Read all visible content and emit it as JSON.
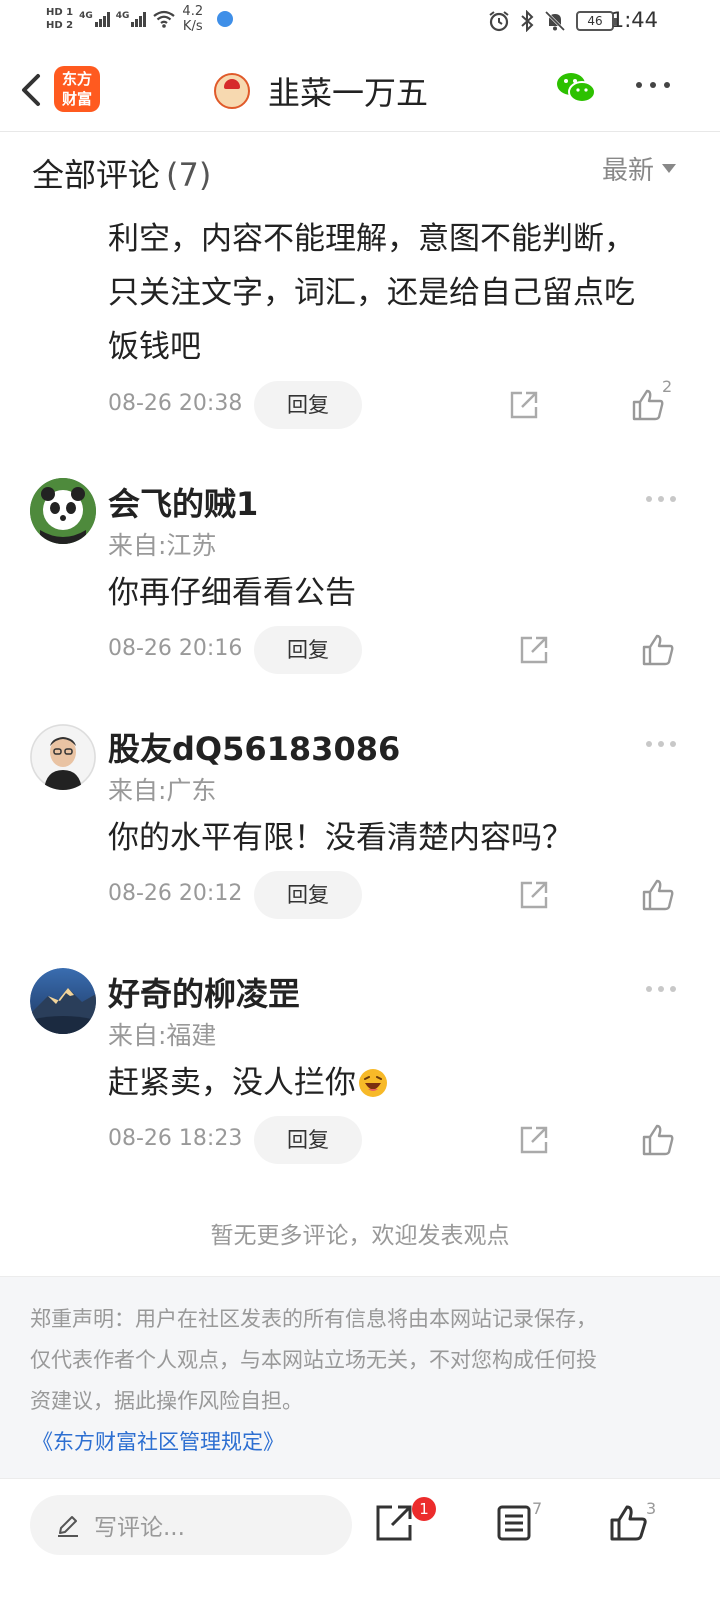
{
  "status_bar": {
    "hd_top": "HD 1",
    "hd_bottom": "HD 2",
    "net1": "4G",
    "net2": "4G",
    "speed_value": "4.2",
    "speed_unit": "K/s",
    "battery": "46",
    "time": "1:44"
  },
  "nav": {
    "logo_line1": "东方",
    "logo_line2": "财富",
    "title": "韭菜一万五"
  },
  "comments_header": {
    "label": "全部评论",
    "count": "(7)",
    "sort": "最新"
  },
  "comments": [
    {
      "text_lines": [
        "利空，内容不能理解，意图不能判断，",
        "只关注文字，词汇，还是给自己留点吃",
        "饭钱吧"
      ],
      "time": "08-26 20:38",
      "reply": "回复",
      "likes": "2"
    },
    {
      "name": "会飞的贼1",
      "location": "来自:江苏",
      "text": "你再仔细看看公告",
      "time": "08-26 20:16",
      "reply": "回复"
    },
    {
      "name": "股友dQ56183086",
      "location": "来自:广东",
      "text": "你的水平有限！没看清楚内容吗？",
      "time": "08-26 20:12",
      "reply": "回复"
    },
    {
      "name": "好奇的柳凌罡",
      "location": "来自:福建",
      "text": "赶紧卖，没人拦你",
      "time": "08-26 18:23",
      "reply": "回复"
    }
  ],
  "no_more": "暂无更多评论，欢迎发表观点",
  "disclaimer": {
    "text_lines": [
      "郑重声明：用户在社区发表的所有信息将由本网站记录保存，",
      "仅代表作者个人观点，与本网站立场无关，不对您构成任何投",
      "资建议，据此操作风险自担。"
    ],
    "link": "《东方财富社区管理规定》"
  },
  "bottom_bar": {
    "placeholder": "写评论...",
    "share_badge": "1",
    "comment_count": "7",
    "like_count": "3"
  },
  "colors": {
    "brand_orange": "#ff5a1f",
    "wechat_green": "#2dc100",
    "badge_red": "#ec2c2c",
    "link_blue": "#2d6fd1"
  }
}
